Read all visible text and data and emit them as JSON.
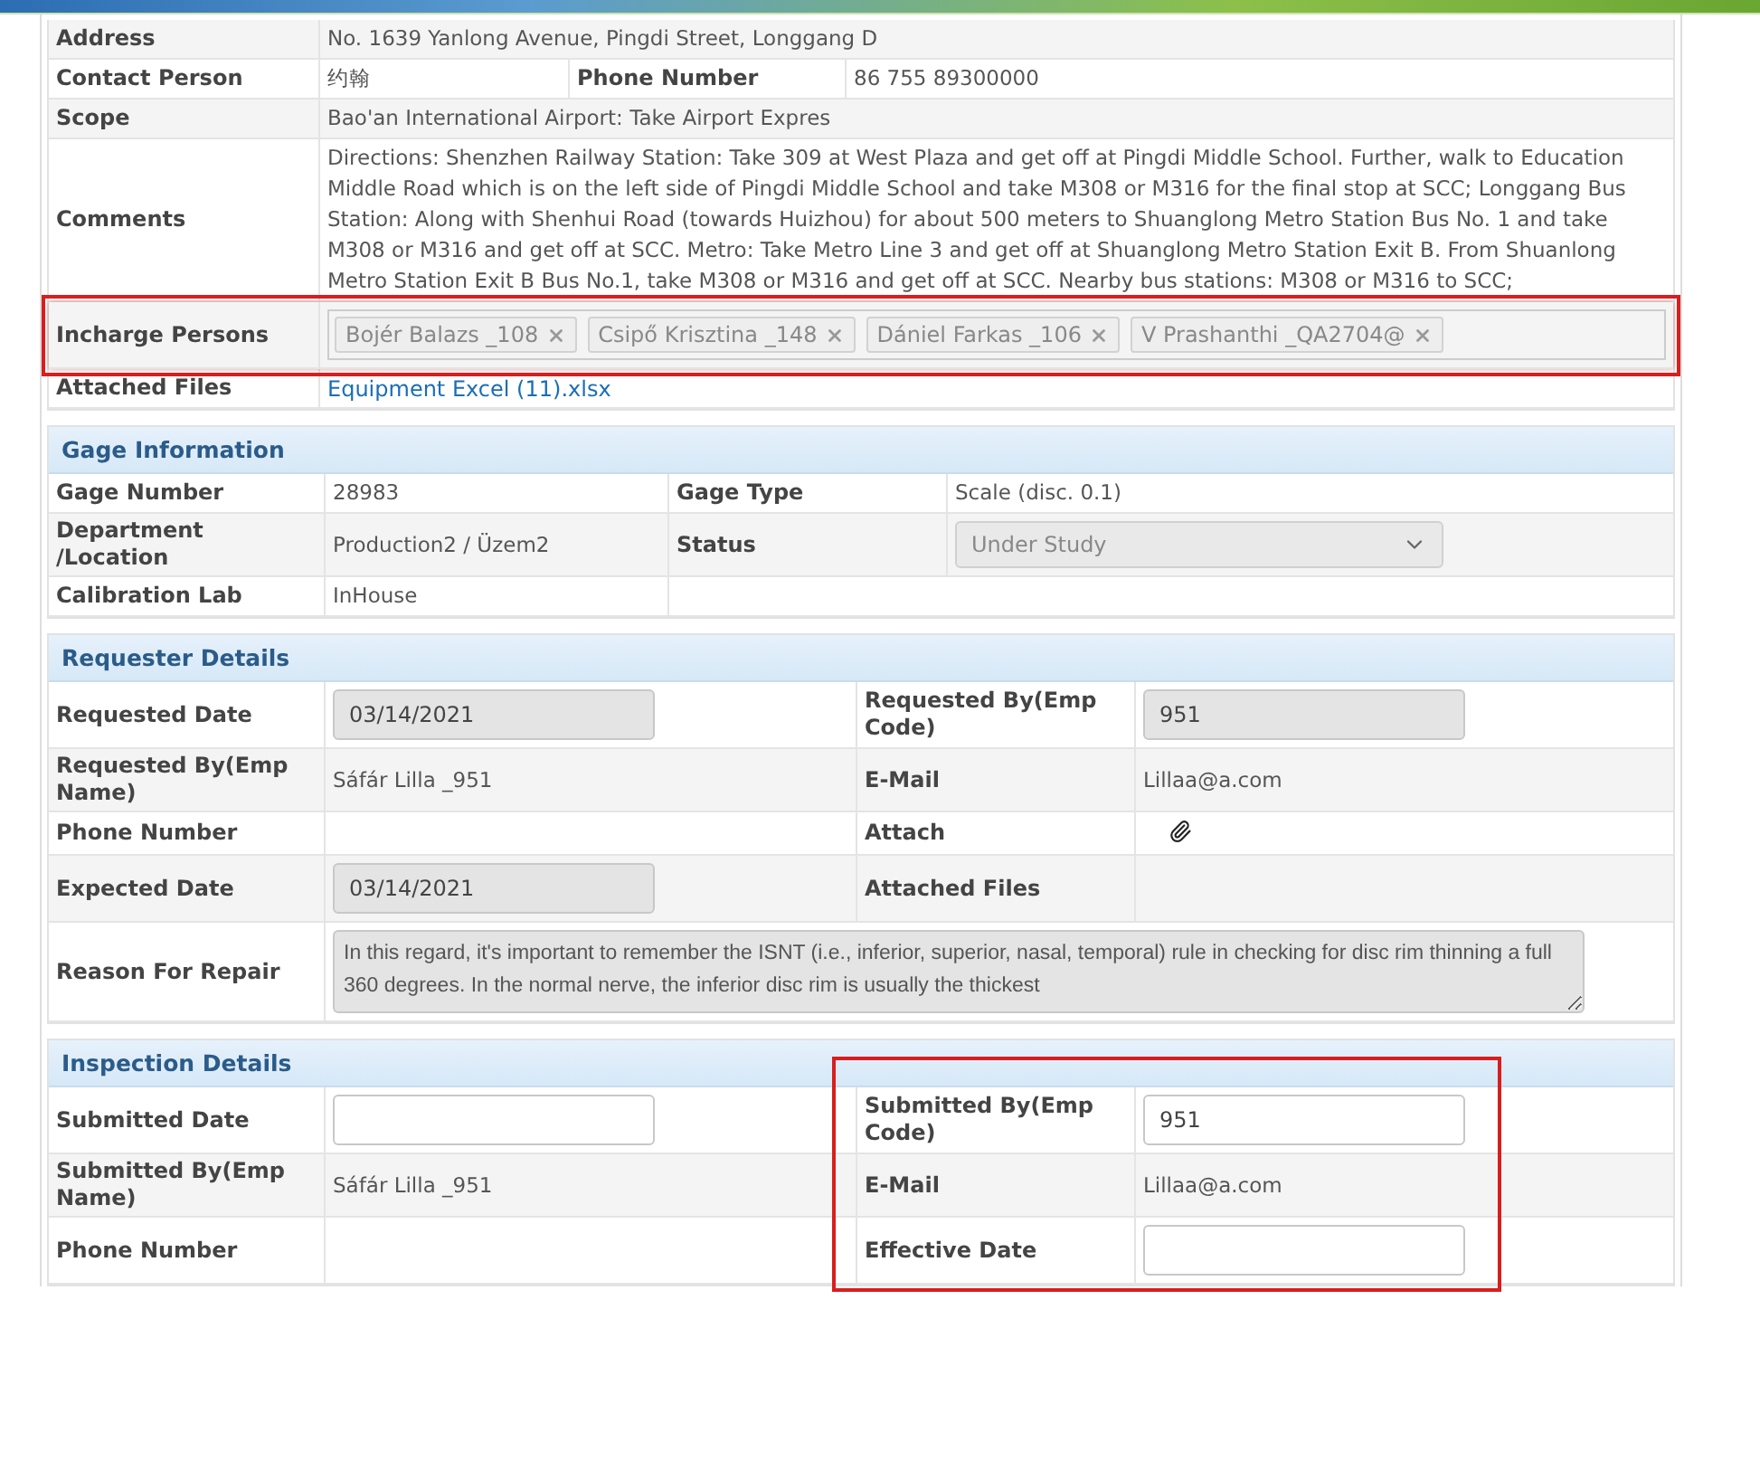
{
  "sections": [
    {
      "kind": "site",
      "rows": [
        {
          "wide": true,
          "highlighted": false,
          "cells": [
            {
              "kind": "label",
              "text": "Address"
            },
            {
              "kind": "text",
              "text": "No. 1639 Yanlong Avenue, Pingdi Street, Longgang D"
            }
          ]
        },
        {
          "wide": false,
          "highlighted": false,
          "cells": [
            {
              "kind": "label",
              "text": "Contact Person"
            },
            {
              "kind": "text",
              "text": "约翰"
            },
            {
              "kind": "label",
              "text": "Phone Number"
            },
            {
              "kind": "text",
              "text": "86 755 89300000"
            }
          ]
        },
        {
          "wide": true,
          "highlighted": false,
          "cells": [
            {
              "kind": "label",
              "text": "Scope"
            },
            {
              "kind": "text",
              "text": "Bao'an International Airport: Take Airport Expres"
            }
          ]
        },
        {
          "wide": true,
          "highlighted": false,
          "cells": [
            {
              "kind": "label",
              "text": "Comments"
            },
            {
              "kind": "text",
              "text": "Directions:   Shenzhen Railway Station: Take 309 at West Plaza and get off at Pingdi Middle School. Further, walk to Education Middle Road which is on the left side of Pingdi Middle School and take M308 or M316 for the final stop at SCC; Longgang Bus Station: Along with Shenhui Road (towards Huizhou) for about 500 meters to Shuanglong Metro Station Bus No. 1 and take M308 or M316 and get off at SCC. Metro: Take Metro Line 3 and get off at Shuanglong Metro Station Exit B. From Shuanlong Metro Station Exit B Bus No.1, take M308 or M316 and get off at SCC. Nearby bus stations: M308 or M316 to SCC;"
            }
          ]
        },
        {
          "wide": true,
          "highlighted": true,
          "cells": [
            {
              "kind": "label",
              "text": "Incharge Persons"
            },
            {
              "kind": "tags",
              "items": [
                "Bojér Balazs _108",
                "Csipő Krisztina _148",
                "Dániel Farkas _106",
                "V Prashanthi _QA2704@"
              ]
            }
          ]
        },
        {
          "wide": true,
          "highlighted": false,
          "cells": [
            {
              "kind": "label",
              "text": "Attached Files"
            },
            {
              "kind": "link",
              "text": "Equipment Excel (11).xlsx"
            }
          ]
        }
      ]
    },
    {
      "kind": "gage",
      "title": "Gage Information",
      "rows": [
        {
          "wide": false,
          "highlighted": false,
          "cells": [
            {
              "kind": "label",
              "text": "Gage Number"
            },
            {
              "kind": "text",
              "text": "28983"
            },
            {
              "kind": "label",
              "text": "Gage Type"
            },
            {
              "kind": "text",
              "text": "Scale (disc. 0.1)"
            }
          ]
        },
        {
          "wide": false,
          "highlighted": false,
          "cells": [
            {
              "kind": "label",
              "text": "Department /Location"
            },
            {
              "kind": "text",
              "text": "Production2 / Üzem2"
            },
            {
              "kind": "label",
              "text": "Status"
            },
            {
              "kind": "select",
              "value": "Under Study",
              "disabled": true
            }
          ]
        },
        {
          "wide": false,
          "highlighted": false,
          "cells": [
            {
              "kind": "label",
              "text": "Calibration Lab"
            },
            {
              "kind": "text",
              "text": "InHouse"
            }
          ]
        }
      ]
    },
    {
      "kind": "request",
      "title": "Requester Details",
      "rows": [
        {
          "wide": false,
          "highlighted": false,
          "cells": [
            {
              "kind": "label",
              "text": "Requested Date"
            },
            {
              "kind": "input",
              "value": "03/14/2021",
              "disabled": true
            },
            {
              "kind": "label",
              "text": "Requested By(Emp Code)"
            },
            {
              "kind": "input",
              "value": "951",
              "disabled": true
            }
          ]
        },
        {
          "wide": false,
          "highlighted": false,
          "cells": [
            {
              "kind": "label",
              "text": "Requested By(Emp Name)"
            },
            {
              "kind": "text",
              "text": "Sáfár Lilla _951"
            },
            {
              "kind": "label",
              "text": "E-Mail"
            },
            {
              "kind": "text",
              "text": "Lillaa@a.com"
            }
          ]
        },
        {
          "wide": false,
          "highlighted": false,
          "cells": [
            {
              "kind": "label",
              "text": "Phone Number"
            },
            {
              "kind": "blank"
            },
            {
              "kind": "label",
              "text": "Attach"
            },
            {
              "kind": "attach"
            }
          ]
        },
        {
          "wide": false,
          "highlighted": false,
          "cells": [
            {
              "kind": "label",
              "text": "Expected Date"
            },
            {
              "kind": "input",
              "value": "03/14/2021",
              "disabled": true
            },
            {
              "kind": "label",
              "text": "Attached Files"
            },
            {
              "kind": "blank"
            }
          ]
        },
        {
          "wide": true,
          "highlighted": false,
          "cells": [
            {
              "kind": "label",
              "text": "Reason For Repair"
            },
            {
              "kind": "textarea",
              "value": "In this regard, it's important to remember the ISNT (i.e., inferior, superior, nasal, temporal) rule in checking for disc rim thinning a full 360 degrees. In the normal nerve, the inferior disc rim is usually the thickest",
              "disabled": true
            }
          ]
        }
      ]
    },
    {
      "kind": "request",
      "title": "Inspection Details",
      "highlight_right": true,
      "rows": [
        {
          "wide": false,
          "highlighted": false,
          "cells": [
            {
              "kind": "label",
              "text": "Submitted Date"
            },
            {
              "kind": "input",
              "disabled": false
            },
            {
              "kind": "label",
              "text": "Submitted By(Emp Code)"
            },
            {
              "kind": "input",
              "value": "951",
              "disabled": false
            }
          ]
        },
        {
          "wide": false,
          "highlighted": false,
          "cells": [
            {
              "kind": "label",
              "text": "Submitted By(Emp Name)"
            },
            {
              "kind": "text",
              "text": "Sáfár Lilla _951"
            },
            {
              "kind": "label",
              "text": "E-Mail"
            },
            {
              "kind": "text",
              "text": "Lillaa@a.com"
            }
          ]
        },
        {
          "wide": false,
          "highlighted": false,
          "cells": [
            {
              "kind": "label",
              "text": "Phone Number"
            },
            {
              "kind": "blank"
            },
            {
              "kind": "label",
              "text": "Effective Date"
            },
            {
              "kind": "input",
              "disabled": false
            }
          ]
        }
      ]
    }
  ]
}
